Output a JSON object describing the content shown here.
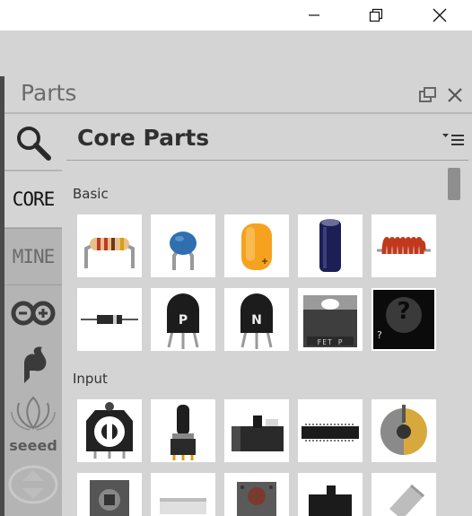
{
  "window": {
    "buttons": [
      "minimize",
      "restore",
      "close"
    ]
  },
  "dock": {
    "title": "Parts",
    "icons": [
      "float-icon",
      "close-icon"
    ]
  },
  "bins": {
    "search_icon": "search-icon",
    "core_label": "CORE",
    "mine_label": "MINE",
    "items": [
      "search",
      "CORE",
      "MINE",
      "arduino",
      "sparkfun",
      "seeed"
    ],
    "seeed_label": "seeed"
  },
  "main": {
    "title": "Core Parts",
    "sections": [
      {
        "label": "Basic",
        "parts": [
          "resistor",
          "ceramic-capacitor",
          "tantalum-capacitor",
          "electrolytic-capacitor",
          "inductor",
          "diode",
          "pnp-transistor",
          "npn-transistor",
          "fet-p",
          "mystery-part"
        ]
      },
      {
        "label": "Input",
        "parts": [
          "potentiometer",
          "rotary-potentiometer",
          "slide-switch",
          "dip-switch",
          "rotary-encoder",
          "stepper-motor",
          "switch",
          "pushbutton",
          "toggle-switch",
          "tilt-switch"
        ]
      }
    ],
    "fet_label": "FET P",
    "mystery_mark": "?"
  },
  "colors": {
    "panel": "#d4d4d4",
    "bins_bg": "#b4b4b4",
    "tile_bg": "#ffffff",
    "accent_orange": "#f6a21e"
  }
}
